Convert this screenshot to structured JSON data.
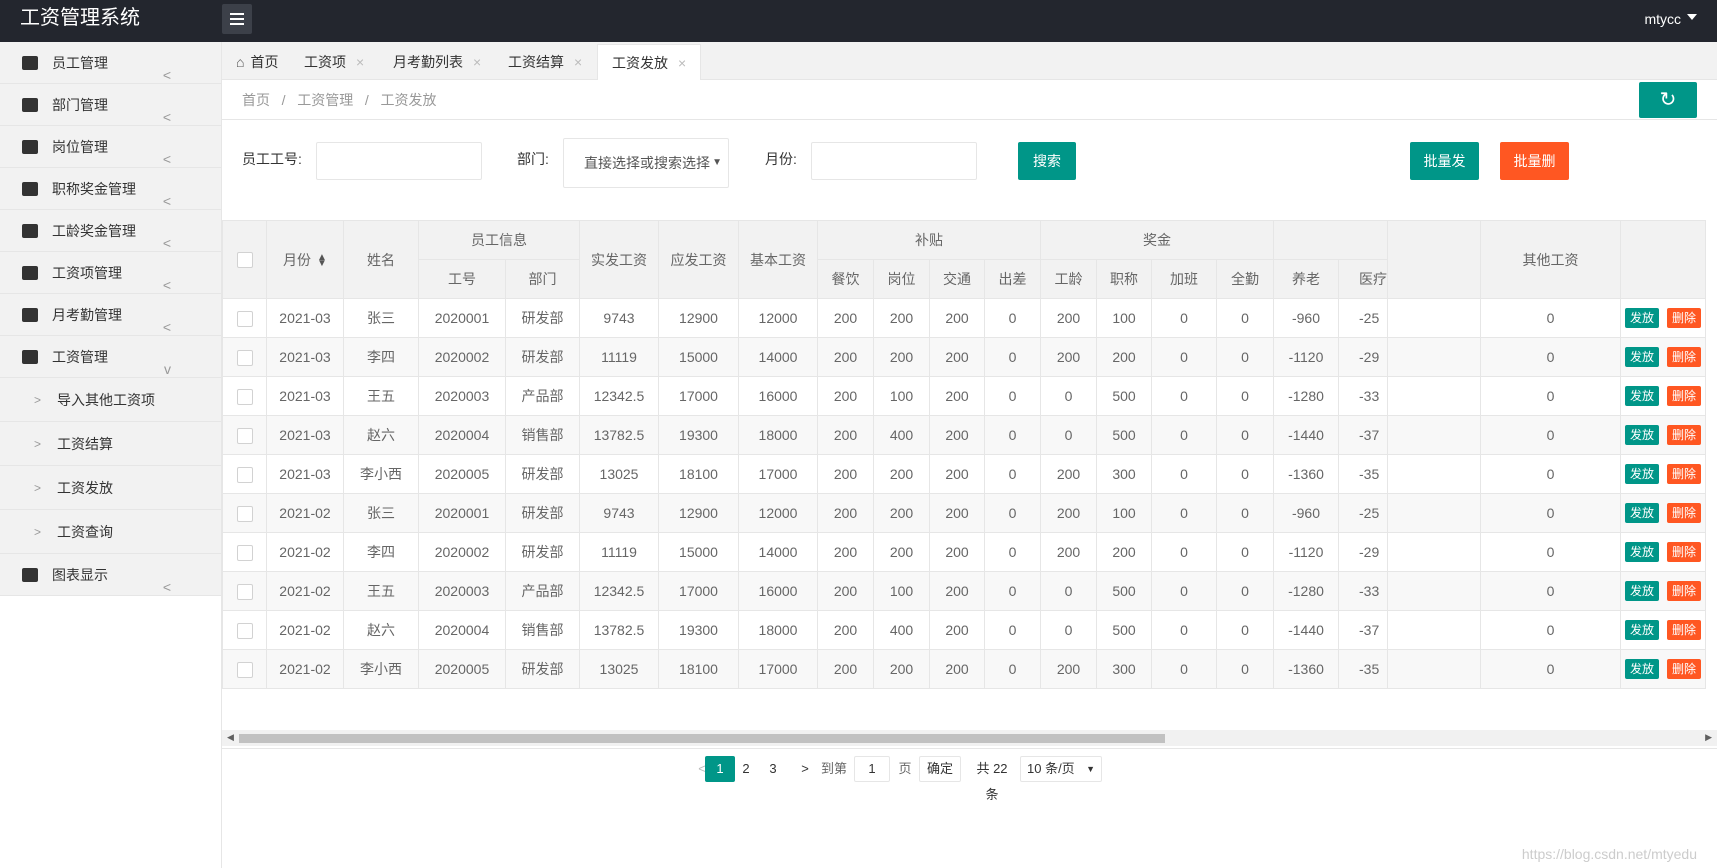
{
  "app": {
    "title": "工资管理系统",
    "user": "mtycc"
  },
  "sidebar": {
    "items": [
      {
        "label": "员工管理",
        "icon": "users-icon"
      },
      {
        "label": "部门管理",
        "icon": "sitemap-icon"
      },
      {
        "label": "岗位管理",
        "icon": "badge-icon"
      },
      {
        "label": "职称奖金管理",
        "icon": "briefcase-icon"
      },
      {
        "label": "工龄奖金管理",
        "icon": "building-icon"
      },
      {
        "label": "工资项管理",
        "icon": "list-icon"
      },
      {
        "label": "月考勤管理",
        "icon": "layers-icon"
      },
      {
        "label": "工资管理",
        "icon": "tag-icon"
      }
    ],
    "subitems": [
      {
        "label": "导入其他工资项"
      },
      {
        "label": "工资结算"
      },
      {
        "label": "工资发放"
      },
      {
        "label": "工资查询"
      }
    ],
    "last_item": {
      "label": "图表显示",
      "icon": "chart-icon"
    }
  },
  "tabs": [
    {
      "label": "首页"
    },
    {
      "label": "工资项"
    },
    {
      "label": "月考勤列表"
    },
    {
      "label": "工资结算"
    },
    {
      "label": "工资发放"
    }
  ],
  "breadcrumb": "首页   /   工资管理   /   工资发放",
  "search": {
    "emp_no_label": "员工工号:",
    "dept_label": "部门:",
    "dept_value": "直接选择或搜索选择",
    "month_label": "月份:",
    "search_btn": "搜索",
    "batch_pay_btn": "批量发放",
    "batch_delete_btn": "批量删除"
  },
  "table": {
    "headers": {
      "month": "月份",
      "name": "姓名",
      "emp_info": "员工信息",
      "emp_no": "工号",
      "dept": "部门",
      "actual": "实发工资",
      "payable": "应发工资",
      "base": "基本工资",
      "subsidy": "补贴",
      "meal": "餐饮",
      "post": "岗位",
      "traffic": "交通",
      "trip": "出差",
      "bonus": "奖金",
      "seniority": "工龄",
      "title": "职称",
      "overtime": "加班",
      "full": "全勤",
      "pension": "养老",
      "medical": "医疗",
      "other": "其他工资"
    },
    "rows": [
      [
        "2021-03",
        "张三",
        "2020001",
        "研发部",
        "9743",
        "12900",
        "12000",
        "200",
        "200",
        "200",
        "0",
        "200",
        "100",
        "0",
        "0",
        "-960",
        "-25",
        "0"
      ],
      [
        "2021-03",
        "李四",
        "2020002",
        "研发部",
        "11119",
        "15000",
        "14000",
        "200",
        "200",
        "200",
        "0",
        "200",
        "200",
        "0",
        "0",
        "-1120",
        "-29",
        "0"
      ],
      [
        "2021-03",
        "王五",
        "2020003",
        "产品部",
        "12342.5",
        "17000",
        "16000",
        "200",
        "100",
        "200",
        "0",
        "0",
        "500",
        "0",
        "0",
        "-1280",
        "-33",
        "0"
      ],
      [
        "2021-03",
        "赵六",
        "2020004",
        "销售部",
        "13782.5",
        "19300",
        "18000",
        "200",
        "400",
        "200",
        "0",
        "0",
        "500",
        "0",
        "0",
        "-1440",
        "-37",
        "0"
      ],
      [
        "2021-03",
        "李小西",
        "2020005",
        "研发部",
        "13025",
        "18100",
        "17000",
        "200",
        "200",
        "200",
        "0",
        "200",
        "300",
        "0",
        "0",
        "-1360",
        "-35",
        "0"
      ],
      [
        "2021-02",
        "张三",
        "2020001",
        "研发部",
        "9743",
        "12900",
        "12000",
        "200",
        "200",
        "200",
        "0",
        "200",
        "100",
        "0",
        "0",
        "-960",
        "-25",
        "0"
      ],
      [
        "2021-02",
        "李四",
        "2020002",
        "研发部",
        "11119",
        "15000",
        "14000",
        "200",
        "200",
        "200",
        "0",
        "200",
        "200",
        "0",
        "0",
        "-1120",
        "-29",
        "0"
      ],
      [
        "2021-02",
        "王五",
        "2020003",
        "产品部",
        "12342.5",
        "17000",
        "16000",
        "200",
        "100",
        "200",
        "0",
        "0",
        "500",
        "0",
        "0",
        "-1280",
        "-33",
        "0"
      ],
      [
        "2021-02",
        "赵六",
        "2020004",
        "销售部",
        "13782.5",
        "19300",
        "18000",
        "200",
        "400",
        "200",
        "0",
        "0",
        "500",
        "0",
        "0",
        "-1440",
        "-37",
        "0"
      ],
      [
        "2021-02",
        "李小西",
        "2020005",
        "研发部",
        "13025",
        "18100",
        "17000",
        "200",
        "200",
        "200",
        "0",
        "200",
        "300",
        "0",
        "0",
        "-1360",
        "-35",
        "0"
      ]
    ],
    "op_pay": "发放",
    "op_delete": "删除"
  },
  "pager": {
    "pages": [
      "1",
      "2",
      "3"
    ],
    "goto_label": "到第",
    "goto_value": "1",
    "page_unit": "页",
    "confirm": "确定",
    "total": "共 22 条",
    "page_size": "10 条/页"
  },
  "watermark": "https://blog.csdn.net/mtyedu",
  "colors": {
    "primary": "#009688",
    "danger": "#ff5722",
    "topbar": "#23262e"
  }
}
